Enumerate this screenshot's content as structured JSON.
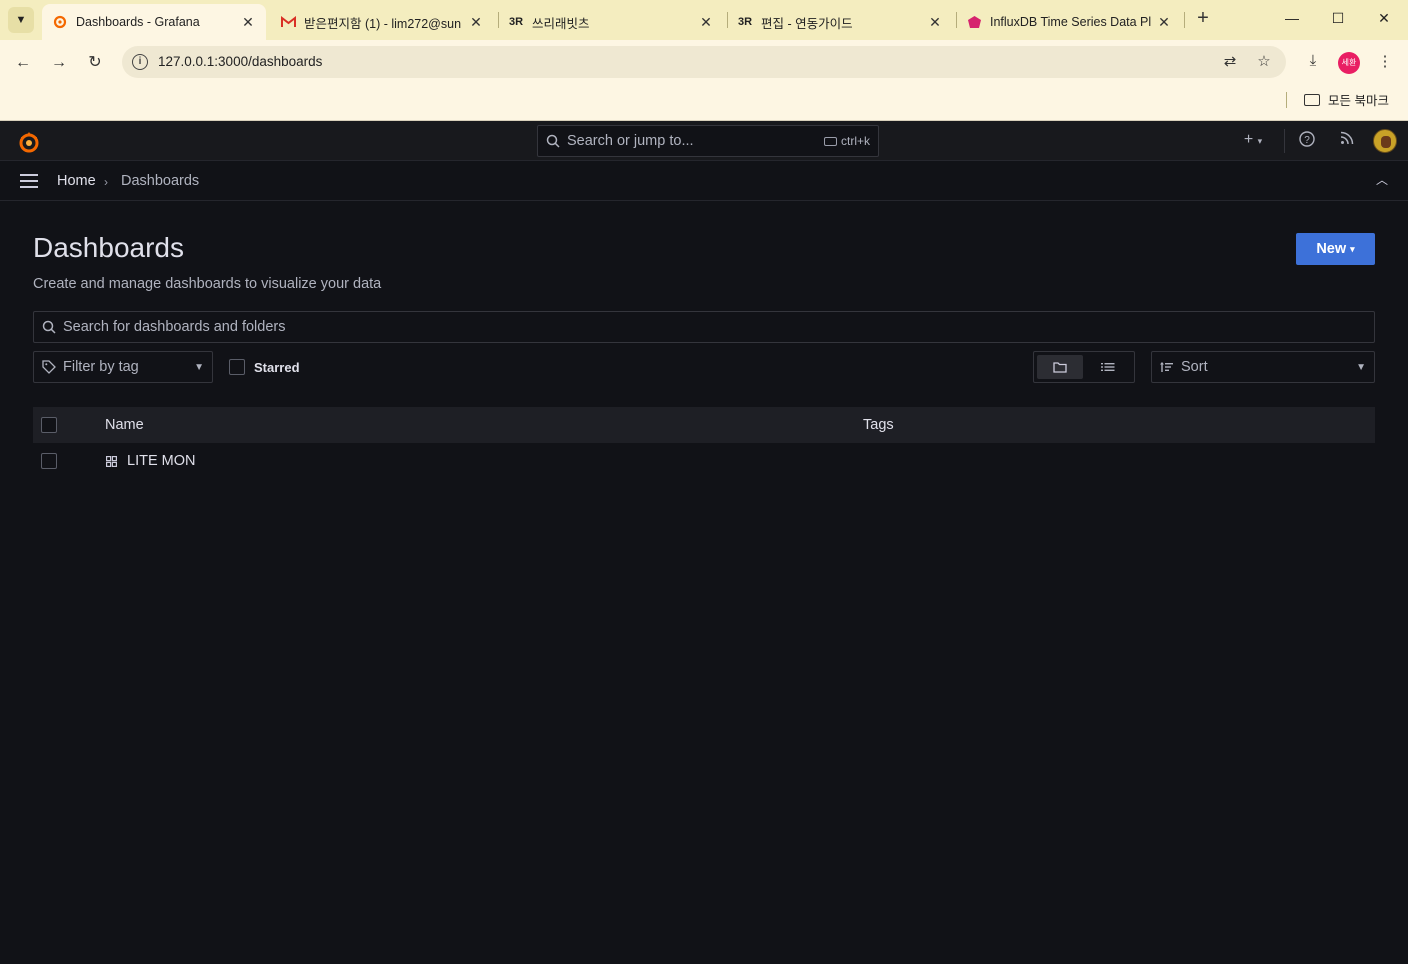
{
  "browser": {
    "tabs": [
      {
        "title": "Dashboards - Grafana",
        "favicon": "grafana-icon",
        "active": true
      },
      {
        "title": "받은편지함 (1) - lim272@sun",
        "favicon": "gmail-icon",
        "active": false
      },
      {
        "title": "쓰리래빗츠",
        "favicon": "3r-icon",
        "active": false
      },
      {
        "title": "편집 - 연동가이드",
        "favicon": "3r-icon",
        "active": false
      },
      {
        "title": "InfluxDB Time Series Data Pl",
        "favicon": "influxdb-icon",
        "active": false
      }
    ],
    "url": "127.0.0.1:3000/dashboards",
    "profile_label": "세환",
    "bookmarks_all": "모든 북마크"
  },
  "grafana": {
    "search_placeholder": "Search or jump to...",
    "search_shortcut": "ctrl+k",
    "breadcrumb": {
      "home": "Home",
      "current": "Dashboards"
    },
    "page": {
      "title": "Dashboards",
      "subtitle": "Create and manage dashboards to visualize your data",
      "new_button": "New"
    },
    "dash_search_placeholder": "Search for dashboards and folders",
    "filter_by_tag": "Filter by tag",
    "starred": "Starred",
    "sort": "Sort",
    "table": {
      "columns": [
        "Name",
        "Tags"
      ],
      "rows": [
        {
          "name": "LITE MON",
          "tags": ""
        }
      ]
    }
  },
  "colors": {
    "accent": "#3d71d9",
    "background": "#111217",
    "grafana_orange": "#f46800"
  }
}
